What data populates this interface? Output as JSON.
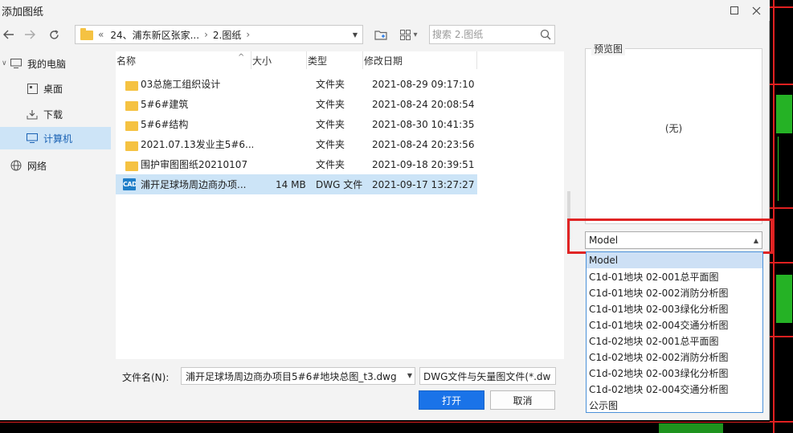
{
  "dialog": {
    "title": "添加图纸"
  },
  "toolbar": {
    "breadcrumb_overflow": "«",
    "breadcrumb_sep": "›",
    "breadcrumb": [
      "24、浦东新区张家...",
      "2.图纸"
    ],
    "view_dropdown": "▾"
  },
  "search": {
    "placeholder": "搜索 2.图纸"
  },
  "nav": {
    "items": [
      {
        "label": "我的电脑",
        "icon": "monitor-icon"
      },
      {
        "label": "桌面",
        "icon": "desktop-icon"
      },
      {
        "label": "下载",
        "icon": "download-icon"
      },
      {
        "label": "计算机",
        "icon": "computer-icon",
        "selected": true
      },
      {
        "label": "网络",
        "icon": "globe-icon"
      }
    ]
  },
  "file_list": {
    "columns": [
      "名称",
      "大小",
      "类型",
      "修改日期"
    ],
    "rows": [
      {
        "name": "03总施工组织设计",
        "size": "",
        "type": "文件夹",
        "date": "2021-08-29 09:17:10",
        "icon": "folder-icon"
      },
      {
        "name": "5#6#建筑",
        "size": "",
        "type": "文件夹",
        "date": "2021-08-24 20:08:54",
        "icon": "folder-icon"
      },
      {
        "name": "5#6#结构",
        "size": "",
        "type": "文件夹",
        "date": "2021-08-30 10:41:35",
        "icon": "folder-icon"
      },
      {
        "name": "2021.07.13发业主5#6...",
        "size": "",
        "type": "文件夹",
        "date": "2021-08-24 20:23:56",
        "icon": "folder-icon"
      },
      {
        "name": "围护审图图纸20210107",
        "size": "",
        "type": "文件夹",
        "date": "2021-09-18 20:39:51",
        "icon": "folder-icon"
      },
      {
        "name": "浦开足球场周边商办项...",
        "size": "14 MB",
        "type": "DWG 文件",
        "date": "2021-09-17 13:27:27",
        "icon": "cad-file-icon",
        "selected": true
      }
    ]
  },
  "cad_badge": "CAD",
  "bottom": {
    "filename_label": "文件名(N):",
    "filename_value": "浦开足球场周边商办项目5#6#地块总图_t3.dwg",
    "filetype_value": "DWG文件与矢量图文件(*.dw",
    "open_label": "打开",
    "cancel_label": "取消"
  },
  "preview": {
    "label": "预览图",
    "empty_text": "(无)"
  },
  "layout_select": {
    "selected": "Model",
    "options": [
      "Model",
      "C1d-01地块 02-001总平面图",
      "C1d-01地块 02-002消防分析图",
      "C1d-01地块 02-003绿化分析图",
      "C1d-01地块 02-004交通分析图",
      "C1d-02地块 02-001总平面图",
      "C1d-02地块 02-002消防分析图",
      "C1d-02地块 02-003绿化分析图",
      "C1d-02地块 02-004交通分析图",
      "公示图"
    ]
  },
  "colors": {
    "accent": "#1a73e8",
    "selection": "#cce4f7",
    "highlight": "#e02424",
    "cad_red": "#e02020",
    "cad_green": "#2bd12b"
  }
}
